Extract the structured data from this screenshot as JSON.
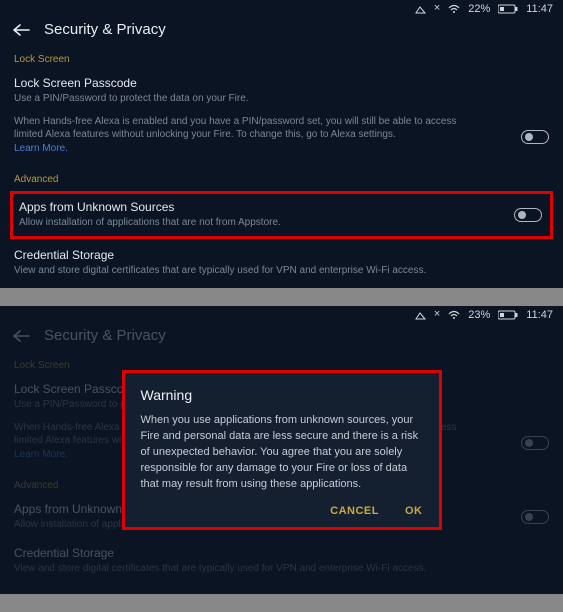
{
  "screen1": {
    "status": {
      "battery_pct": "22%",
      "time": "11:47"
    },
    "title": "Security & Privacy",
    "sections": {
      "lock": {
        "label": "Lock Screen",
        "passcode": {
          "title": "Lock Screen Passcode",
          "sub": "Use a PIN/Password to protect the data on your Fire."
        },
        "alexa_note": "When Hands-free Alexa is enabled and you have a PIN/password set, you will still be able to access limited Alexa features without unlocking your Fire. To change this, go to Alexa settings.",
        "learn_more": "Learn More."
      },
      "advanced": {
        "label": "Advanced",
        "unknown": {
          "title": "Apps from Unknown Sources",
          "sub": "Allow installation of applications that are not from Appstore."
        },
        "credential": {
          "title": "Credential Storage",
          "sub": "View and store digital certificates that are typically used for VPN and enterprise Wi-Fi access."
        }
      }
    }
  },
  "screen2": {
    "status": {
      "battery_pct": "23%",
      "time": "11:47"
    },
    "title": "Security & Privacy",
    "dialog": {
      "title": "Warning",
      "body": "When you use applications from unknown sources, your Fire and personal data are less secure and there is a risk of unexpected behavior. You agree that you are solely responsible for any damage to your Fire or loss of data that may result from using these applications.",
      "cancel": "CANCEL",
      "ok": "OK"
    },
    "sections": {
      "lock": {
        "label": "Lock Screen",
        "passcode": {
          "title": "Lock Screen Passcode",
          "sub": "Use a PIN/Password to protect the data on your Fire."
        },
        "alexa_note": "When Hands-free Alexa is enabled and you have a PIN/password set, you will still be able to access limited Alexa features without unlocking your Fire. To change this, go to Alexa settings.",
        "learn_more": "Learn More."
      },
      "advanced": {
        "label": "Advanced",
        "unknown": {
          "title": "Apps from Unknown Sources",
          "sub": "Allow installation of applications that are not from Appstore."
        },
        "credential": {
          "title": "Credential Storage",
          "sub": "View and store digital certificates that are typically used for VPN and enterprise Wi-Fi access."
        }
      }
    }
  }
}
